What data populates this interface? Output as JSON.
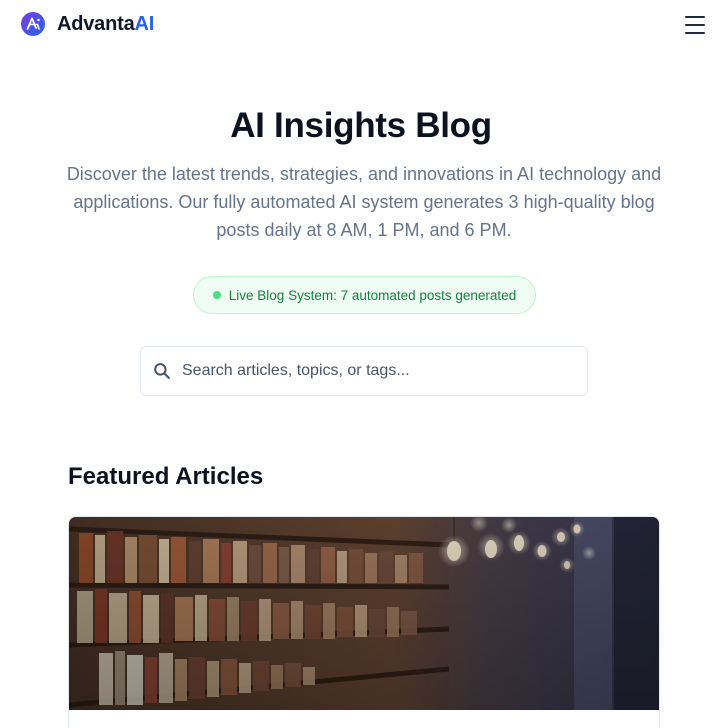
{
  "header": {
    "brand_prefix": "Advanta",
    "brand_suffix": "AI",
    "logo_icon": "advanta-logo-icon",
    "menu_icon": "hamburger-menu-icon"
  },
  "hero": {
    "title": "AI Insights Blog",
    "description": "Discover the latest trends, strategies, and innovations in AI technology and applications. Our fully automated AI system generates 3 high-quality blog posts daily at 8 AM, 1 PM, and 6 PM."
  },
  "status": {
    "text": "Live Blog System: 7 automated posts generated",
    "color": "#15803d"
  },
  "search": {
    "placeholder": "Search articles, topics, or tags...",
    "value": "",
    "icon": "search-icon"
  },
  "featured": {
    "heading": "Featured Articles",
    "cards": [
      {
        "image_description": "library bookshelf photo"
      }
    ]
  },
  "colors": {
    "accent": "#2563eb",
    "status_green": "#22c55e",
    "muted_text": "#64748b"
  }
}
